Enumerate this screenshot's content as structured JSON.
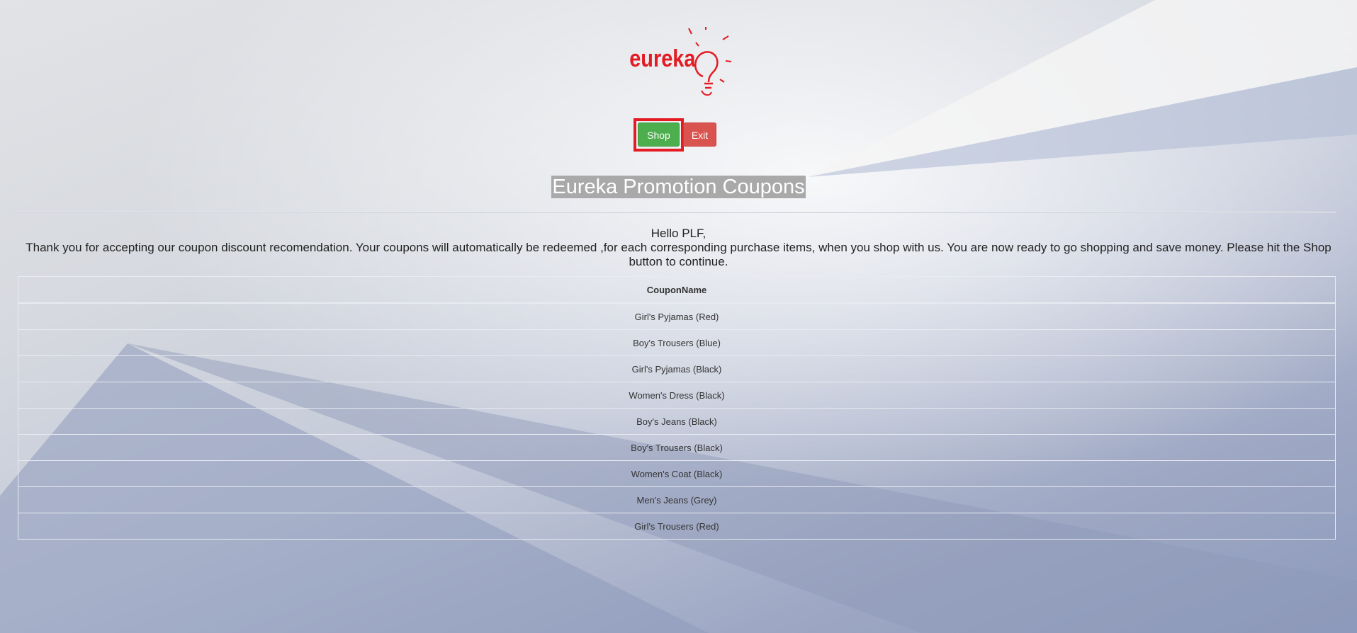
{
  "header": {
    "logo_alt": "eureka",
    "shop_label": "Shop",
    "exit_label": "Exit"
  },
  "page": {
    "title": "Eureka Promotion Coupons",
    "greeting": "Hello PLF,",
    "message": "Thank you for accepting our coupon discount recomendation. Your coupons will automatically be redeemed ,for each corresponding purchase items, when you shop with us. You are now ready to go shopping and save money. Please hit the Shop button to continue."
  },
  "table": {
    "header": "CouponName",
    "rows": [
      "Girl's Pyjamas (Red)",
      "Boy's Trousers (Blue)",
      "Girl's Pyjamas (Black)",
      "Women's Dress (Black)",
      "Boy's Jeans (Black)",
      "Boy's Trousers (Black)",
      "Women's Coat (Black)",
      "Men's Jeans (Grey)",
      "Girl's Trousers (Red)"
    ]
  },
  "colors": {
    "logo_red": "#e31b23",
    "shop_green": "#4cae4c",
    "exit_red": "#d9534f",
    "highlight_frame": "#e31b23"
  },
  "icons": {
    "logo": "lightbulb-logo-icon"
  }
}
